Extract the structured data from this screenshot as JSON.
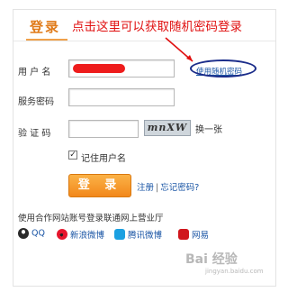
{
  "header": {
    "title": "登录"
  },
  "annotation": {
    "text": "点击这里可以获取随机密码登录"
  },
  "form": {
    "username_label": "用 户 名",
    "random_password_link": "使用随机密码",
    "service_password_label": "服务密码",
    "captcha_label": "验 证 码",
    "captcha_image_text": "mnXW",
    "refresh_captcha": "换一张",
    "remember_label": "记住用户名",
    "remember_checked": "✓",
    "login_button": "登 录",
    "register_link": "注册",
    "separator": "|",
    "forgot_link": "忘记密码?"
  },
  "partners": {
    "title": "使用合作网站账号登录联通网上营业厅",
    "items": [
      {
        "label": "QQ",
        "icon": "penguin-icon",
        "color": "#2a2a2a"
      },
      {
        "label": "新浪微博",
        "icon": "weibo-icon",
        "color": "#e6162d"
      },
      {
        "label": "腾讯微博",
        "icon": "tencent-weibo-icon",
        "color": "#1ba0e1"
      },
      {
        "label": "网易",
        "icon": "netease-icon",
        "color": "#d0161c"
      }
    ]
  },
  "watermark": {
    "text": "Bai 经验",
    "sub": "jingyan.baidu.com"
  },
  "colors": {
    "accent": "#e07b1a",
    "annotation": "#e01010",
    "link": "#1a55a5",
    "button": "#f2881b"
  }
}
